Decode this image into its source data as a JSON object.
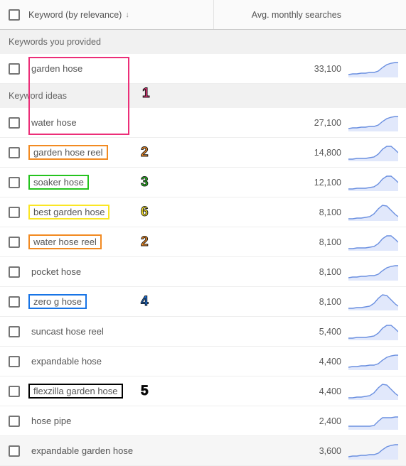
{
  "header": {
    "keyword_col": "Keyword (by relevance)",
    "searches_col": "Avg. monthly searches"
  },
  "sections": {
    "provided": "Keywords you provided",
    "ideas": "Keyword ideas"
  },
  "rows": [
    {
      "keyword": "garden hose",
      "searches": "33,100",
      "spark": "rise",
      "highlight": null,
      "section": "provided",
      "annot": null
    },
    {
      "keyword": "water hose",
      "searches": "27,100",
      "spark": "rise",
      "highlight": null,
      "section": "ideas",
      "annot": null
    },
    {
      "keyword": "garden hose reel",
      "searches": "14,800",
      "spark": "bump",
      "highlight": "orange",
      "section": "ideas",
      "annot": {
        "num": "2",
        "color": "#f28a21"
      }
    },
    {
      "keyword": "soaker hose",
      "searches": "12,100",
      "spark": "bump",
      "highlight": "green",
      "section": "ideas",
      "annot": {
        "num": "3",
        "color": "#25c31e"
      }
    },
    {
      "keyword": "best garden hose",
      "searches": "8,100",
      "spark": "peak",
      "highlight": "yellow",
      "section": "ideas",
      "annot": {
        "num": "6",
        "color": "#fbe624"
      }
    },
    {
      "keyword": "water hose reel",
      "searches": "8,100",
      "spark": "bump",
      "highlight": "orange",
      "section": "ideas",
      "annot": {
        "num": "2",
        "color": "#f28a21"
      }
    },
    {
      "keyword": "pocket hose",
      "searches": "8,100",
      "spark": "rise",
      "highlight": null,
      "section": "ideas",
      "annot": null
    },
    {
      "keyword": "zero g hose",
      "searches": "8,100",
      "spark": "peak",
      "highlight": "blue",
      "section": "ideas",
      "annot": {
        "num": "4",
        "color": "#1774e6"
      }
    },
    {
      "keyword": "suncast hose reel",
      "searches": "5,400",
      "spark": "bump",
      "highlight": null,
      "section": "ideas",
      "annot": null
    },
    {
      "keyword": "expandable hose",
      "searches": "4,400",
      "spark": "rise",
      "highlight": null,
      "section": "ideas",
      "annot": null
    },
    {
      "keyword": "flexzilla garden hose",
      "searches": "4,400",
      "spark": "peak",
      "highlight": "black",
      "section": "ideas",
      "annot": {
        "num": "5",
        "color": "#000"
      }
    },
    {
      "keyword": "hose pipe",
      "searches": "2,400",
      "spark": "step",
      "highlight": null,
      "section": "ideas",
      "annot": null
    },
    {
      "keyword": "expandable garden hose",
      "searches": "3,600",
      "spark": "rise",
      "highlight": null,
      "section": "ideas",
      "annot": null,
      "alt": true
    }
  ],
  "pink_annot": {
    "num": "1",
    "color": "#ec2e78"
  },
  "chart_data": [
    {
      "type": "line",
      "series_name": "garden hose trend",
      "y_approx": [
        20,
        22,
        21,
        23,
        24,
        25,
        26,
        32,
        55,
        70,
        78,
        80
      ],
      "ylim": [
        0,
        100
      ]
    },
    {
      "type": "line",
      "series_name": "water hose trend",
      "y_approx": [
        20,
        21,
        22,
        22,
        23,
        24,
        25,
        30,
        52,
        68,
        76,
        78
      ],
      "ylim": [
        0,
        100
      ]
    },
    {
      "type": "line",
      "series_name": "garden hose reel trend",
      "y_approx": [
        15,
        16,
        16,
        17,
        17,
        18,
        20,
        28,
        55,
        78,
        80,
        60
      ],
      "ylim": [
        0,
        100
      ]
    },
    {
      "type": "line",
      "series_name": "soaker hose trend",
      "y_approx": [
        12,
        13,
        13,
        14,
        14,
        16,
        20,
        30,
        55,
        78,
        80,
        55
      ],
      "ylim": [
        0,
        100
      ]
    },
    {
      "type": "line",
      "series_name": "best garden hose trend",
      "y_approx": [
        12,
        13,
        14,
        14,
        15,
        18,
        24,
        45,
        75,
        82,
        60,
        38
      ],
      "ylim": [
        0,
        100
      ]
    },
    {
      "type": "line",
      "series_name": "water hose reel trend",
      "y_approx": [
        14,
        15,
        15,
        16,
        16,
        18,
        22,
        32,
        58,
        78,
        78,
        56
      ],
      "ylim": [
        0,
        100
      ]
    },
    {
      "type": "line",
      "series_name": "pocket hose trend",
      "y_approx": [
        18,
        19,
        19,
        20,
        20,
        22,
        26,
        36,
        56,
        72,
        78,
        80
      ],
      "ylim": [
        0,
        100
      ]
    },
    {
      "type": "line",
      "series_name": "zero g hose trend",
      "y_approx": [
        12,
        13,
        13,
        14,
        15,
        18,
        26,
        48,
        78,
        82,
        56,
        34
      ],
      "ylim": [
        0,
        100
      ]
    },
    {
      "type": "line",
      "series_name": "suncast hose reel trend",
      "y_approx": [
        14,
        15,
        15,
        16,
        16,
        18,
        22,
        32,
        58,
        78,
        78,
        56
      ],
      "ylim": [
        0,
        100
      ]
    },
    {
      "type": "line",
      "series_name": "expandable hose trend",
      "y_approx": [
        18,
        19,
        19,
        20,
        20,
        22,
        26,
        36,
        56,
        72,
        78,
        80
      ],
      "ylim": [
        0,
        100
      ]
    },
    {
      "type": "line",
      "series_name": "flexzilla garden hose trend",
      "y_approx": [
        12,
        13,
        13,
        14,
        15,
        18,
        26,
        48,
        78,
        82,
        62,
        40
      ],
      "ylim": [
        0,
        100
      ]
    },
    {
      "type": "line",
      "series_name": "hose pipe trend",
      "y_approx": [
        22,
        23,
        23,
        23,
        22,
        23,
        24,
        38,
        62,
        64,
        64,
        66
      ],
      "ylim": [
        0,
        100
      ]
    },
    {
      "type": "line",
      "series_name": "expandable garden hose trend",
      "y_approx": [
        18,
        19,
        19,
        20,
        20,
        22,
        26,
        36,
        56,
        72,
        78,
        80
      ],
      "ylim": [
        0,
        100
      ]
    }
  ]
}
